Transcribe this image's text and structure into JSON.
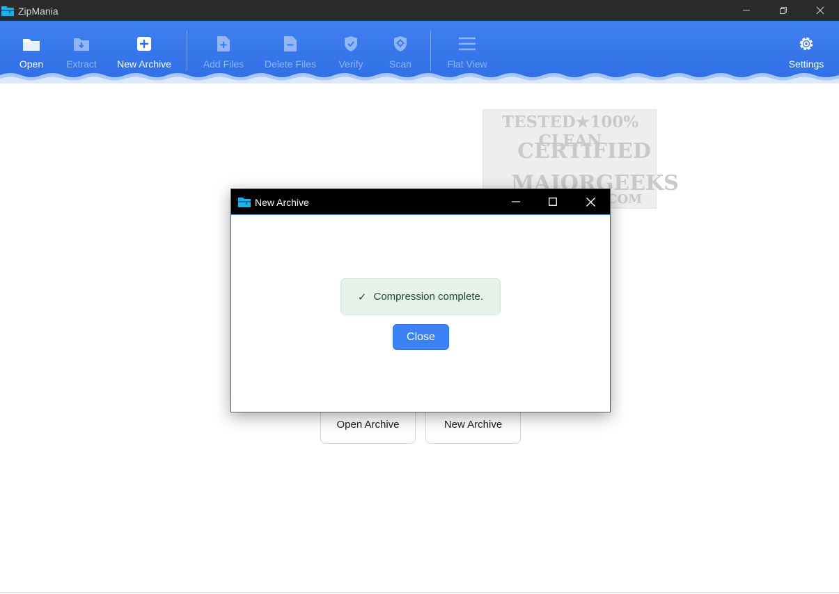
{
  "window": {
    "title": "ZipMania",
    "controls": {
      "minimize": "—",
      "restore": "❐",
      "close": "✕"
    }
  },
  "toolbar": {
    "open": "Open",
    "extract": "Extract",
    "new_archive": "New Archive",
    "add_files": "Add Files",
    "delete_files": "Delete Files",
    "verify": "Verify",
    "scan": "Scan",
    "flat_view": "Flat View",
    "settings": "Settings"
  },
  "main": {
    "open_archive_button": "Open Archive",
    "new_archive_button": "New Archive"
  },
  "watermark": {
    "line1": "TESTED★100% CLEAN",
    "line2": "CERTIFIED",
    "line3": "MAJORGEEKS",
    "line4": ".COM"
  },
  "dialog": {
    "title": "New Archive",
    "message": "Compression complete.",
    "check_glyph": "✓",
    "close_button": "Close"
  },
  "colors": {
    "toolbar": "#3a7aee",
    "accent_button": "#3b82f6",
    "success_bg": "#e6f2ea"
  }
}
